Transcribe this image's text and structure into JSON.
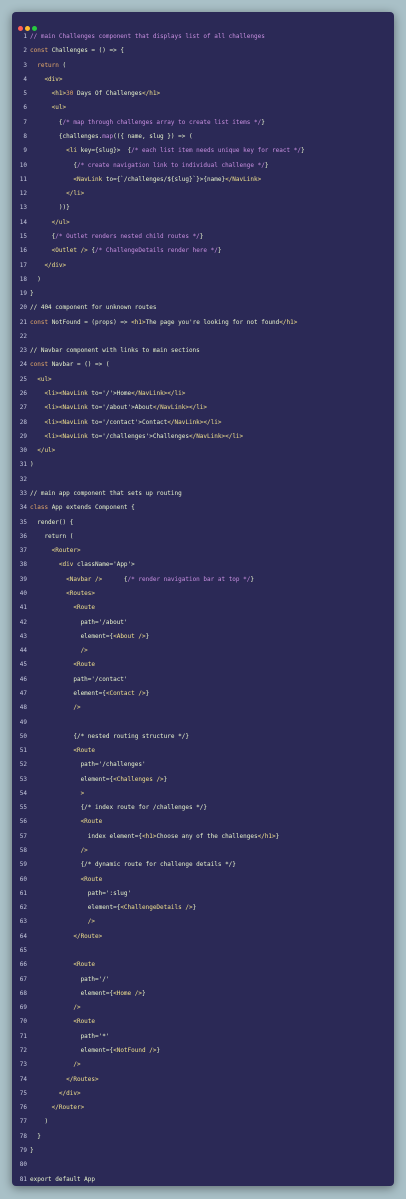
{
  "window": {
    "controls": [
      "close",
      "minimize",
      "maximize"
    ]
  },
  "colors": {
    "background": "#a9c0c7",
    "editor": "#2b2956",
    "comment": "#c88fe0",
    "keyword": "#e5a96a",
    "text": "#e8f4cd"
  },
  "lines": [
    {
      "n": "1",
      "tokens": [
        {
          "c": "comment",
          "t": "// main Challenges component that displays list of all challenges"
        }
      ]
    },
    {
      "n": "2",
      "tokens": [
        {
          "c": "keyword",
          "t": "const "
        },
        {
          "c": "plain",
          "t": "Challenges = () => {"
        }
      ]
    },
    {
      "n": "3",
      "tokens": [
        {
          "c": "keyword",
          "t": "  return "
        },
        {
          "c": "plain",
          "t": "("
        }
      ]
    },
    {
      "n": "4",
      "tokens": [
        {
          "c": "tag",
          "t": "    <div>"
        }
      ]
    },
    {
      "n": "5",
      "tokens": [
        {
          "c": "tag",
          "t": "      <h1>"
        },
        {
          "c": "keyword",
          "t": "30"
        },
        {
          "c": "plain",
          "t": " Days Of Challenges"
        },
        {
          "c": "tag",
          "t": "</h1>"
        }
      ]
    },
    {
      "n": "6",
      "tokens": [
        {
          "c": "tag",
          "t": "      <ul>"
        }
      ]
    },
    {
      "n": "7",
      "tokens": [
        {
          "c": "plain",
          "t": "        {"
        },
        {
          "c": "comment",
          "t": "/* map through challenges array to create list items */"
        },
        {
          "c": "plain",
          "t": "}"
        }
      ]
    },
    {
      "n": "8",
      "tokens": [
        {
          "c": "plain",
          "t": "        {challenges."
        },
        {
          "c": "comment",
          "t": "map"
        },
        {
          "c": "plain",
          "t": "(({ name, slug }) => ("
        }
      ]
    },
    {
      "n": "9",
      "tokens": [
        {
          "c": "tag",
          "t": "          <li "
        },
        {
          "c": "plain",
          "t": "key={slug}>  {"
        },
        {
          "c": "comment",
          "t": "/* each list item needs unique key for react */"
        },
        {
          "c": "plain",
          "t": "}"
        }
      ]
    },
    {
      "n": "10",
      "tokens": [
        {
          "c": "plain",
          "t": "            {"
        },
        {
          "c": "comment",
          "t": "/* create navigation link to individual challenge */"
        },
        {
          "c": "plain",
          "t": "}"
        }
      ]
    },
    {
      "n": "11",
      "tokens": [
        {
          "c": "tag",
          "t": "            <NavLink "
        },
        {
          "c": "plain",
          "t": "to={`/challenges/${slug}`}>{name}"
        },
        {
          "c": "tag",
          "t": "</NavLink>"
        }
      ]
    },
    {
      "n": "12",
      "tokens": [
        {
          "c": "tag",
          "t": "          </li>"
        }
      ]
    },
    {
      "n": "13",
      "tokens": [
        {
          "c": "plain",
          "t": "        ))}"
        }
      ]
    },
    {
      "n": "14",
      "tokens": [
        {
          "c": "tag",
          "t": "      </ul>"
        }
      ]
    },
    {
      "n": "15",
      "tokens": [
        {
          "c": "plain",
          "t": "      {"
        },
        {
          "c": "comment",
          "t": "/* Outlet renders nested child routes */"
        },
        {
          "c": "plain",
          "t": "}"
        }
      ]
    },
    {
      "n": "16",
      "tokens": [
        {
          "c": "tag",
          "t": "      <Outlet /> "
        },
        {
          "c": "plain",
          "t": "{"
        },
        {
          "c": "comment",
          "t": "/* ChallengeDetails render here */"
        },
        {
          "c": "plain",
          "t": "}"
        }
      ]
    },
    {
      "n": "17",
      "tokens": [
        {
          "c": "tag",
          "t": "    </div>"
        }
      ]
    },
    {
      "n": "18",
      "tokens": [
        {
          "c": "plain",
          "t": "  )"
        }
      ]
    },
    {
      "n": "19",
      "tokens": [
        {
          "c": "plain",
          "t": "}"
        }
      ]
    },
    {
      "n": "20",
      "tokens": [
        {
          "c": "plain",
          "t": "// 404 component for unknown routes"
        }
      ]
    },
    {
      "n": "21",
      "tokens": [
        {
          "c": "keyword",
          "t": "const "
        },
        {
          "c": "plain",
          "t": "NotFound = (props) => "
        },
        {
          "c": "tag",
          "t": "<h1>"
        },
        {
          "c": "plain",
          "t": "The page you're looking for not found"
        },
        {
          "c": "tag",
          "t": "</h1>"
        }
      ]
    },
    {
      "n": "22",
      "tokens": []
    },
    {
      "n": "23",
      "tokens": [
        {
          "c": "plain",
          "t": "// Navbar component with links to main sections"
        }
      ]
    },
    {
      "n": "24",
      "tokens": [
        {
          "c": "keyword",
          "t": "const "
        },
        {
          "c": "plain",
          "t": "Navbar = () => ("
        }
      ]
    },
    {
      "n": "25",
      "tokens": [
        {
          "c": "tag",
          "t": "  <ul>"
        }
      ]
    },
    {
      "n": "26",
      "tokens": [
        {
          "c": "tag",
          "t": "    <li><NavLink "
        },
        {
          "c": "plain",
          "t": "to='/'>Home"
        },
        {
          "c": "tag",
          "t": "</NavLink></li>"
        }
      ]
    },
    {
      "n": "27",
      "tokens": [
        {
          "c": "tag",
          "t": "    <li><NavLink "
        },
        {
          "c": "plain",
          "t": "to='/about'>About"
        },
        {
          "c": "tag",
          "t": "</NavLink></li>"
        }
      ]
    },
    {
      "n": "28",
      "tokens": [
        {
          "c": "tag",
          "t": "    <li><NavLink "
        },
        {
          "c": "plain",
          "t": "to='/contact'>Contact"
        },
        {
          "c": "tag",
          "t": "</NavLink></li>"
        }
      ]
    },
    {
      "n": "29",
      "tokens": [
        {
          "c": "tag",
          "t": "    <li><NavLink "
        },
        {
          "c": "plain",
          "t": "to='/challenges'>Challenges"
        },
        {
          "c": "tag",
          "t": "</NavLink></li>"
        }
      ]
    },
    {
      "n": "30",
      "tokens": [
        {
          "c": "tag",
          "t": "  </ul>"
        }
      ]
    },
    {
      "n": "31",
      "tokens": [
        {
          "c": "plain",
          "t": ")"
        }
      ]
    },
    {
      "n": "32",
      "tokens": []
    },
    {
      "n": "33",
      "tokens": [
        {
          "c": "plain",
          "t": "// main app component that sets up routing"
        }
      ]
    },
    {
      "n": "34",
      "tokens": [
        {
          "c": "keyword",
          "t": "class "
        },
        {
          "c": "plain",
          "t": "App extends Component {"
        }
      ]
    },
    {
      "n": "35",
      "tokens": [
        {
          "c": "plain",
          "t": "  render() {"
        }
      ]
    },
    {
      "n": "36",
      "tokens": [
        {
          "c": "plain",
          "t": "    return ("
        }
      ]
    },
    {
      "n": "37",
      "tokens": [
        {
          "c": "tag",
          "t": "      <Router>"
        }
      ]
    },
    {
      "n": "38",
      "tokens": [
        {
          "c": "tag",
          "t": "        <div "
        },
        {
          "c": "plain",
          "t": "className='App'>"
        }
      ]
    },
    {
      "n": "39",
      "tokens": [
        {
          "c": "tag",
          "t": "          <Navbar />"
        },
        {
          "c": "plain",
          "t": "      {"
        },
        {
          "c": "comment",
          "t": "/* render navigation bar at top */"
        },
        {
          "c": "plain",
          "t": "}"
        }
      ]
    },
    {
      "n": "40",
      "tokens": [
        {
          "c": "tag",
          "t": "          <Routes>"
        }
      ]
    },
    {
      "n": "41",
      "tokens": [
        {
          "c": "tag",
          "t": "            <Route"
        }
      ]
    },
    {
      "n": "42",
      "tokens": [
        {
          "c": "plain",
          "t": "              path='/about'"
        }
      ]
    },
    {
      "n": "43",
      "tokens": [
        {
          "c": "plain",
          "t": "              element={"
        },
        {
          "c": "tag",
          "t": "<About />"
        },
        {
          "c": "plain",
          "t": "}"
        }
      ]
    },
    {
      "n": "44",
      "tokens": [
        {
          "c": "tag",
          "t": "              />"
        }
      ]
    },
    {
      "n": "45",
      "tokens": [
        {
          "c": "tag",
          "t": "            <Route"
        }
      ]
    },
    {
      "n": "46",
      "tokens": [
        {
          "c": "plain",
          "t": "            path='/contact'"
        }
      ]
    },
    {
      "n": "47",
      "tokens": [
        {
          "c": "plain",
          "t": "            element={"
        },
        {
          "c": "tag",
          "t": "<Contact />"
        },
        {
          "c": "plain",
          "t": "}"
        }
      ]
    },
    {
      "n": "48",
      "tokens": [
        {
          "c": "tag",
          "t": "            />"
        }
      ]
    },
    {
      "n": "49",
      "tokens": []
    },
    {
      "n": "50",
      "tokens": [
        {
          "c": "plain",
          "t": "            {/* nested routing structure */}"
        }
      ]
    },
    {
      "n": "51",
      "tokens": [
        {
          "c": "tag",
          "t": "            <Route"
        }
      ]
    },
    {
      "n": "52",
      "tokens": [
        {
          "c": "plain",
          "t": "              path='/challenges'"
        }
      ]
    },
    {
      "n": "53",
      "tokens": [
        {
          "c": "plain",
          "t": "              element={"
        },
        {
          "c": "tag",
          "t": "<Challenges />"
        },
        {
          "c": "plain",
          "t": "}"
        }
      ]
    },
    {
      "n": "54",
      "tokens": [
        {
          "c": "tag",
          "t": "              >"
        }
      ]
    },
    {
      "n": "55",
      "tokens": [
        {
          "c": "plain",
          "t": "              {/* index route for /challenges */}"
        }
      ]
    },
    {
      "n": "56",
      "tokens": [
        {
          "c": "tag",
          "t": "              <Route"
        }
      ]
    },
    {
      "n": "57",
      "tokens": [
        {
          "c": "plain",
          "t": "                index element={"
        },
        {
          "c": "tag",
          "t": "<h1>"
        },
        {
          "c": "plain",
          "t": "Choose any of the challenges"
        },
        {
          "c": "tag",
          "t": "</h1>"
        },
        {
          "c": "plain",
          "t": "}"
        }
      ]
    },
    {
      "n": "58",
      "tokens": [
        {
          "c": "tag",
          "t": "              />"
        }
      ]
    },
    {
      "n": "59",
      "tokens": [
        {
          "c": "plain",
          "t": "              {/* dynamic route for challenge details */}"
        }
      ]
    },
    {
      "n": "60",
      "tokens": [
        {
          "c": "tag",
          "t": "              <Route"
        }
      ]
    },
    {
      "n": "61",
      "tokens": [
        {
          "c": "plain",
          "t": "                path=':slug'"
        }
      ]
    },
    {
      "n": "62",
      "tokens": [
        {
          "c": "plain",
          "t": "                element={"
        },
        {
          "c": "tag",
          "t": "<ChallengeDetails />"
        },
        {
          "c": "plain",
          "t": "}"
        }
      ]
    },
    {
      "n": "63",
      "tokens": [
        {
          "c": "tag",
          "t": "                />"
        }
      ]
    },
    {
      "n": "64",
      "tokens": [
        {
          "c": "tag",
          "t": "            </Route>"
        }
      ]
    },
    {
      "n": "65",
      "tokens": []
    },
    {
      "n": "66",
      "tokens": [
        {
          "c": "tag",
          "t": "            <Route"
        }
      ]
    },
    {
      "n": "67",
      "tokens": [
        {
          "c": "plain",
          "t": "              path='/'"
        }
      ]
    },
    {
      "n": "68",
      "tokens": [
        {
          "c": "plain",
          "t": "              element={"
        },
        {
          "c": "tag",
          "t": "<Home />"
        },
        {
          "c": "plain",
          "t": "}"
        }
      ]
    },
    {
      "n": "69",
      "tokens": [
        {
          "c": "tag",
          "t": "            />"
        }
      ]
    },
    {
      "n": "70",
      "tokens": [
        {
          "c": "tag",
          "t": "            <Route"
        }
      ]
    },
    {
      "n": "71",
      "tokens": [
        {
          "c": "plain",
          "t": "              path='*'"
        }
      ]
    },
    {
      "n": "72",
      "tokens": [
        {
          "c": "plain",
          "t": "              element={"
        },
        {
          "c": "tag",
          "t": "<NotFound />"
        },
        {
          "c": "plain",
          "t": "}"
        }
      ]
    },
    {
      "n": "73",
      "tokens": [
        {
          "c": "tag",
          "t": "            />"
        }
      ]
    },
    {
      "n": "74",
      "tokens": [
        {
          "c": "tag",
          "t": "          </Routes>"
        }
      ]
    },
    {
      "n": "75",
      "tokens": [
        {
          "c": "tag",
          "t": "        </div>"
        }
      ]
    },
    {
      "n": "76",
      "tokens": [
        {
          "c": "tag",
          "t": "      </Router>"
        }
      ]
    },
    {
      "n": "77",
      "tokens": [
        {
          "c": "plain",
          "t": "    )"
        }
      ]
    },
    {
      "n": "78",
      "tokens": [
        {
          "c": "plain",
          "t": "  }"
        }
      ]
    },
    {
      "n": "79",
      "tokens": [
        {
          "c": "plain",
          "t": "}"
        }
      ]
    },
    {
      "n": "80",
      "tokens": []
    },
    {
      "n": "81",
      "tokens": [
        {
          "c": "plain",
          "t": "export default App"
        }
      ]
    }
  ]
}
